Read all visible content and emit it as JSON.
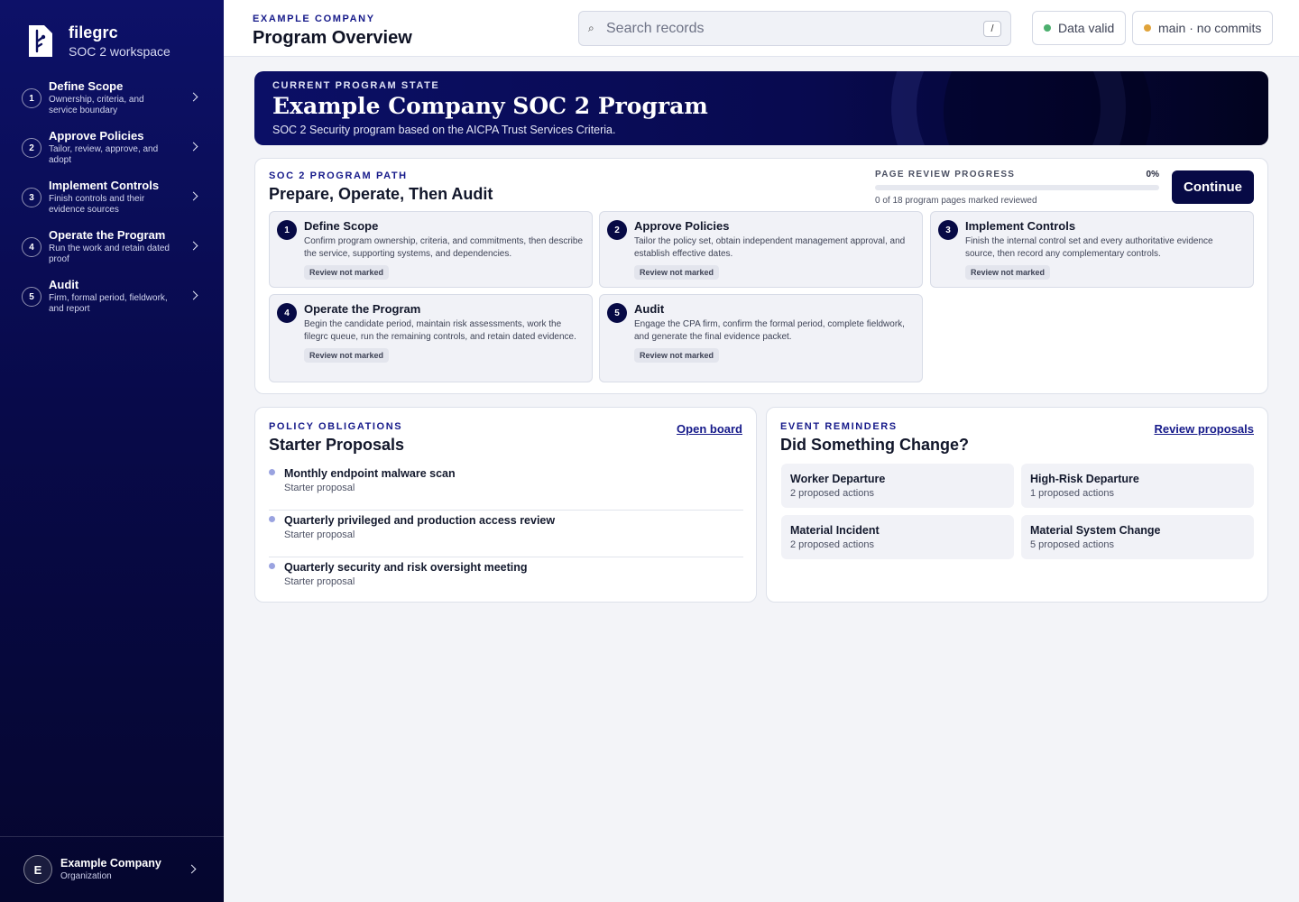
{
  "brand": {
    "name": "filegrc",
    "subtitle": "SOC 2 workspace"
  },
  "sidebar": {
    "items": [
      {
        "num": "1",
        "title": "Define Scope",
        "desc": "Ownership, criteria, and service boundary"
      },
      {
        "num": "2",
        "title": "Approve Policies",
        "desc": "Tailor, review, approve, and adopt"
      },
      {
        "num": "3",
        "title": "Implement Controls",
        "desc": "Finish controls and their evidence sources"
      },
      {
        "num": "4",
        "title": "Operate the Program",
        "desc": "Run the work and retain dated proof"
      },
      {
        "num": "5",
        "title": "Audit",
        "desc": "Firm, formal period, fieldwork, and report"
      }
    ],
    "org": {
      "initial": "E",
      "name": "Example Company",
      "role": "Organization"
    }
  },
  "header": {
    "kicker": "EXAMPLE COMPANY",
    "title": "Program Overview",
    "search_placeholder": "Search records",
    "search_icon": "⌕",
    "search_shortcut": "/",
    "status_valid": "Data valid",
    "status_branch": "main · no commits"
  },
  "colors": {
    "valid": "#4caf6e",
    "branch": "#e0a33a",
    "accent": "#161a8a",
    "navy": "#070a45"
  },
  "banner": {
    "kicker": "CURRENT PROGRAM STATE",
    "title": "Example Company SOC 2 Program",
    "subtitle": "SOC 2 Security program based on the AICPA Trust Services Criteria."
  },
  "program_path": {
    "kicker": "SOC 2 PROGRAM PATH",
    "title": "Prepare, Operate, Then Audit",
    "progress_label": "PAGE REVIEW PROGRESS",
    "progress_pct": "0%",
    "progress_fraction": 0,
    "progress_note": "0 of 18 program pages marked reviewed",
    "continue_label": "Continue",
    "steps": [
      {
        "num": "1",
        "title": "Define Scope",
        "desc": "Confirm program ownership, criteria, and commitments, then describe the service, supporting systems, and dependencies.",
        "badge": "Review not marked"
      },
      {
        "num": "2",
        "title": "Approve Policies",
        "desc": "Tailor the policy set, obtain independent management approval, and establish effective dates.",
        "badge": "Review not marked"
      },
      {
        "num": "3",
        "title": "Implement Controls",
        "desc": "Finish the internal control set and every authoritative evidence source, then record any complementary controls.",
        "badge": "Review not marked"
      },
      {
        "num": "4",
        "title": "Operate the Program",
        "desc": "Begin the candidate period, maintain risk assessments, work the filegrc queue, run the remaining controls, and retain dated evidence.",
        "badge": "Review not marked"
      },
      {
        "num": "5",
        "title": "Audit",
        "desc": "Engage the CPA firm, confirm the formal period, complete fieldwork, and generate the final evidence packet.",
        "badge": "Review not marked"
      }
    ]
  },
  "policy": {
    "kicker": "POLICY OBLIGATIONS",
    "title": "Starter Proposals",
    "link": "Open board",
    "items": [
      {
        "title": "Monthly endpoint malware scan",
        "sub": "Starter proposal"
      },
      {
        "title": "Quarterly privileged and production access review",
        "sub": "Starter proposal"
      },
      {
        "title": "Quarterly security and risk oversight meeting",
        "sub": "Starter proposal"
      }
    ]
  },
  "events": {
    "kicker": "EVENT REMINDERS",
    "title": "Did Something Change?",
    "link": "Review proposals",
    "items": [
      {
        "title": "Worker Departure",
        "sub": "2 proposed actions"
      },
      {
        "title": "High-Risk Departure",
        "sub": "1 proposed actions"
      },
      {
        "title": "Material Incident",
        "sub": "2 proposed actions"
      },
      {
        "title": "Material System Change",
        "sub": "5 proposed actions"
      }
    ]
  }
}
